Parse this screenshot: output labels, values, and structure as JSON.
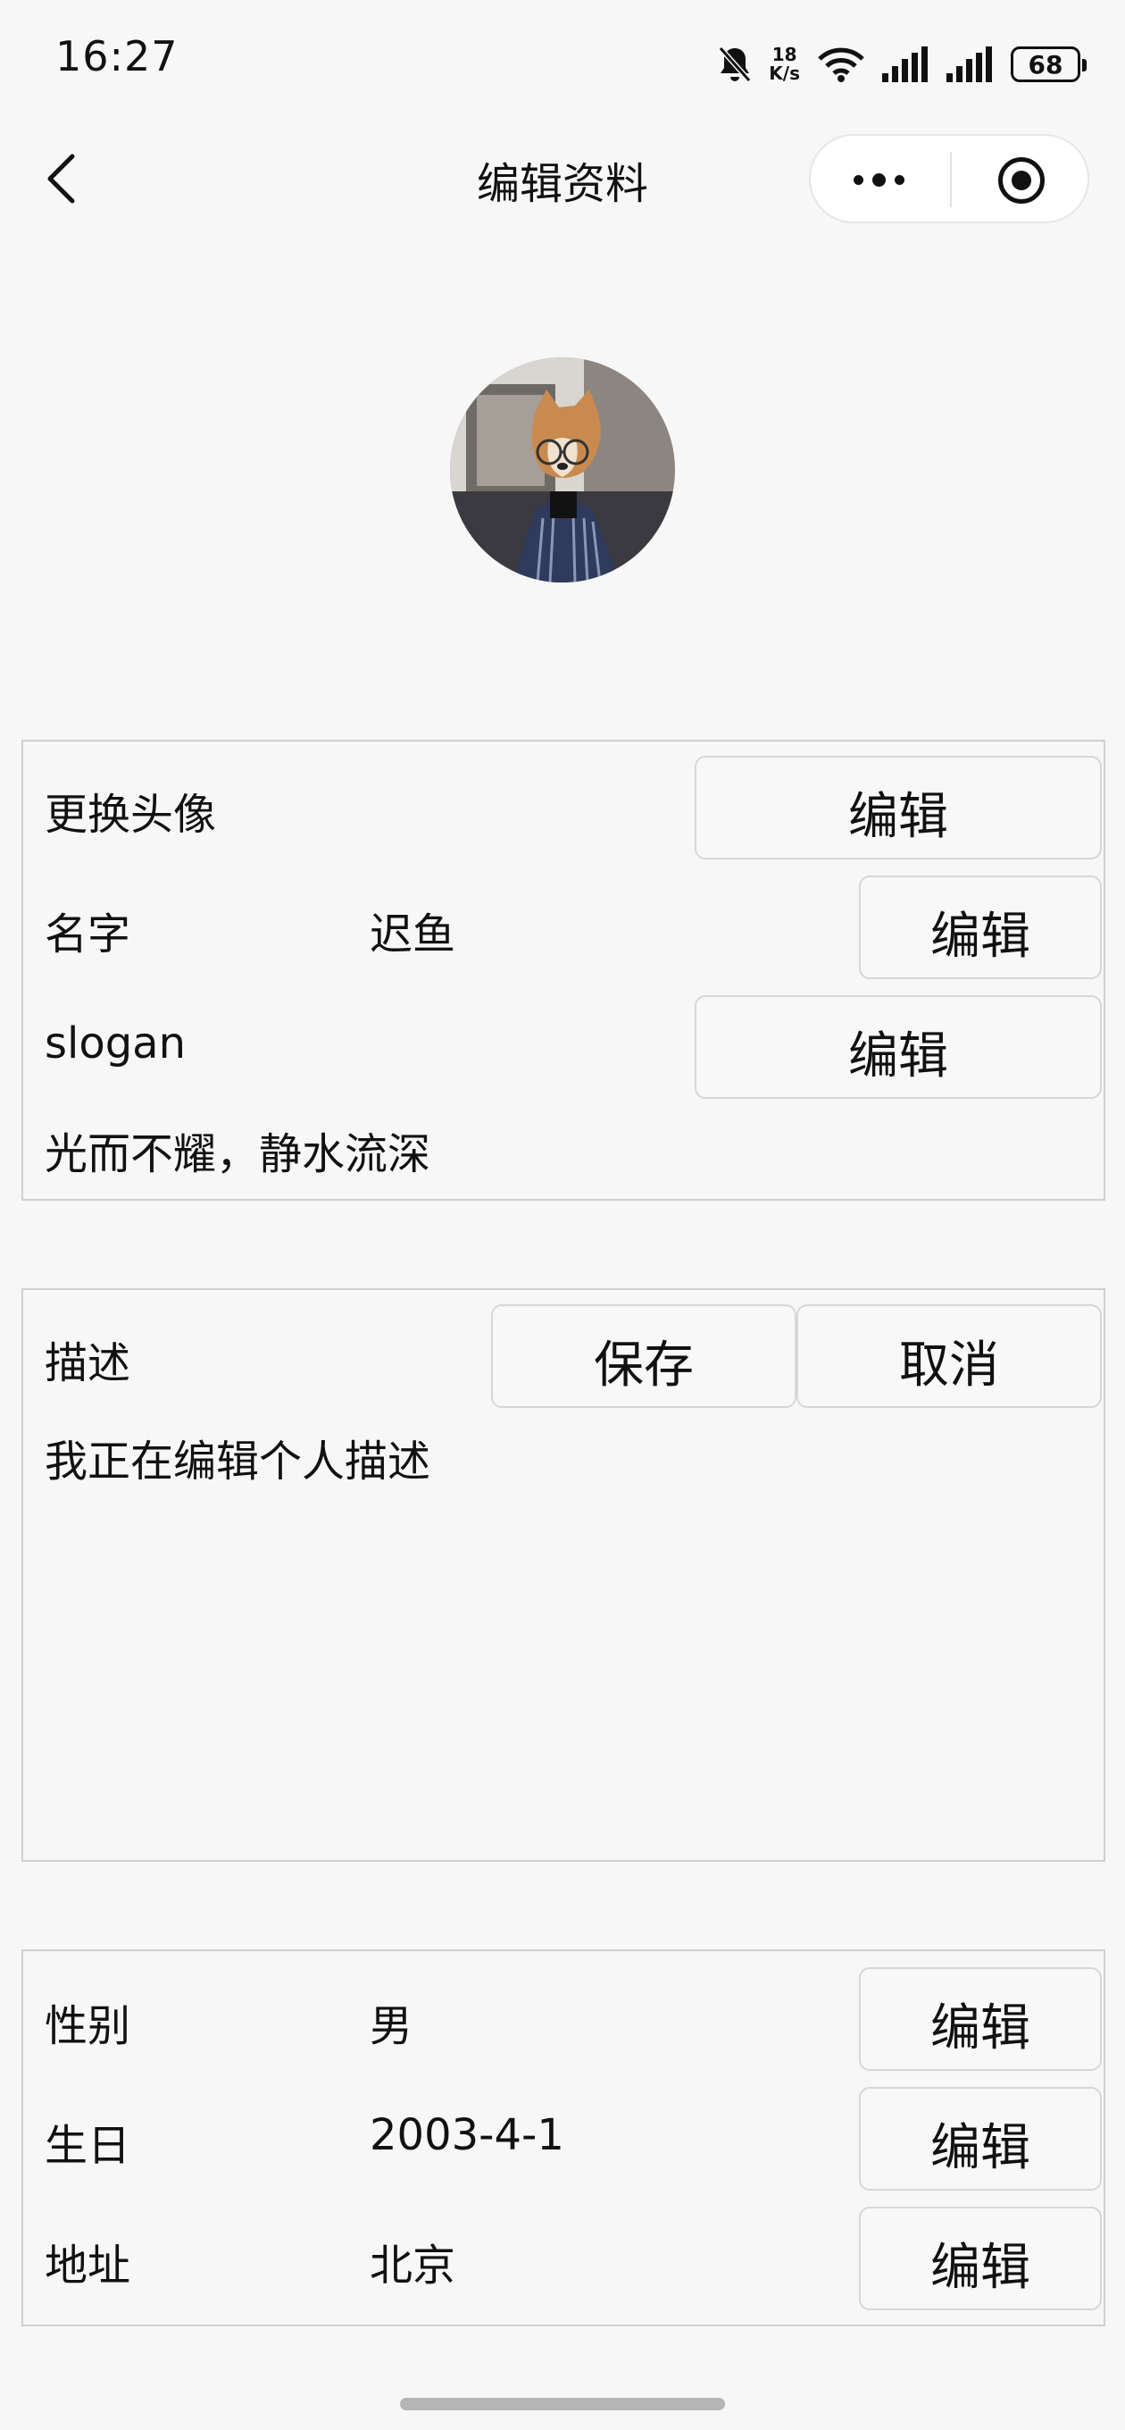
{
  "status_bar": {
    "time": "16:27",
    "speed_value": "18",
    "speed_unit": "K/s",
    "battery": "68",
    "icons": [
      "bell-off-icon",
      "wifi-icon",
      "signal-icon",
      "signal-icon",
      "battery-icon"
    ]
  },
  "nav": {
    "title": "编辑资料",
    "back_icon": "chevron-left-icon",
    "capsule_icons": [
      "more-icon",
      "target-icon"
    ]
  },
  "profile_box": {
    "avatar_label": "更换头像",
    "avatar_edit": "编辑",
    "name_label": "名字",
    "name_value": "迟鱼",
    "name_edit": "编辑",
    "slogan_label": "slogan",
    "slogan_edit": "编辑",
    "slogan_value": "光而不耀，静水流深"
  },
  "desc_box": {
    "label": "描述",
    "save": "保存",
    "cancel": "取消",
    "text": "我正在编辑个人描述"
  },
  "info_box": {
    "rows": [
      {
        "label": "性别",
        "value": "男",
        "edit": "编辑"
      },
      {
        "label": "生日",
        "value": "2003-4-1",
        "edit": "编辑"
      },
      {
        "label": "地址",
        "value": "北京",
        "edit": "编辑"
      }
    ]
  }
}
